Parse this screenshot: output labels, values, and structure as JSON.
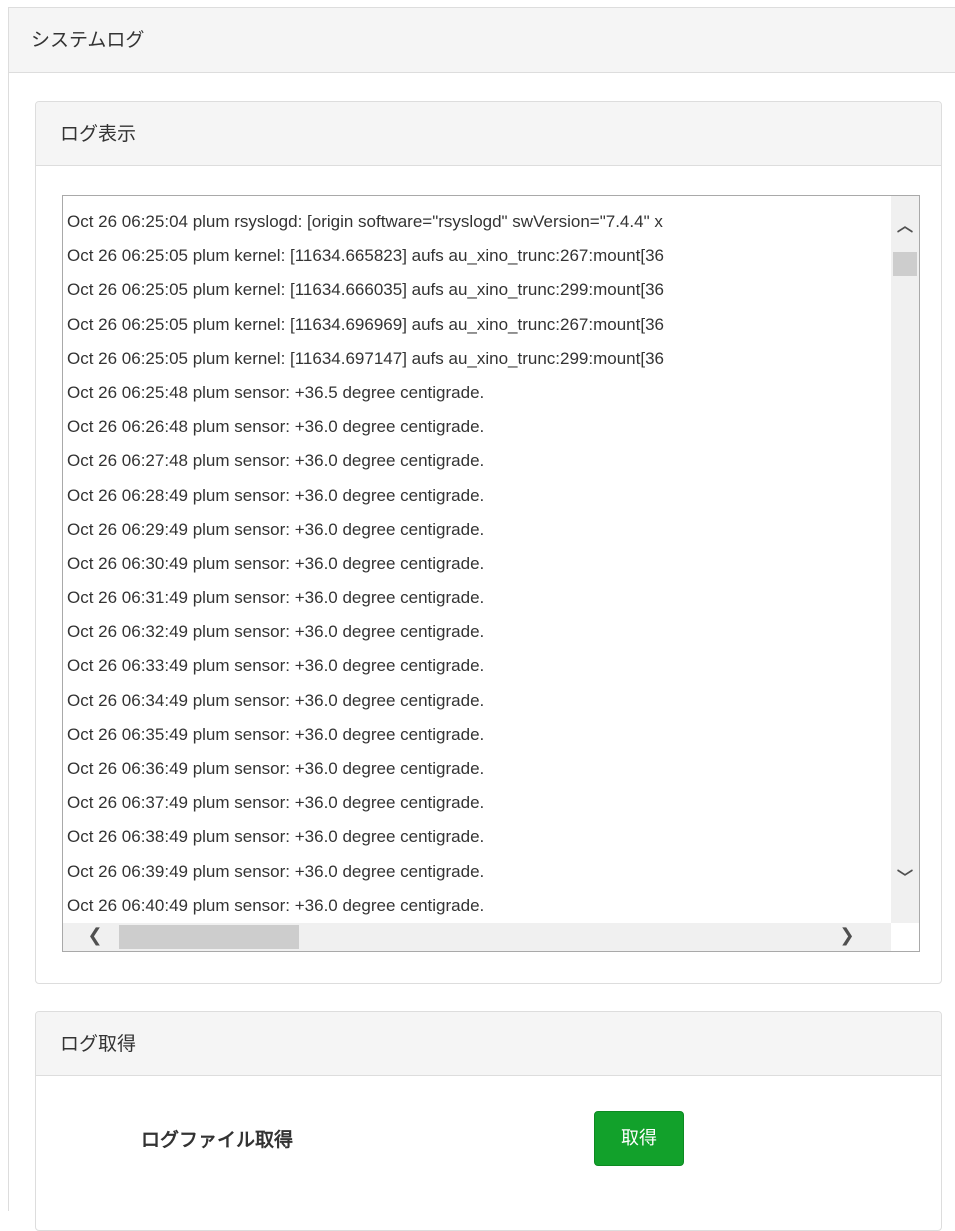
{
  "page": {
    "title": "システムログ"
  },
  "log_view": {
    "heading": "ログ表示",
    "lines": [
      "Oct 26 06:25:04 plum rsyslogd: [origin software=\"rsyslogd\" swVersion=\"7.4.4\" x",
      "Oct 26 06:25:05 plum kernel: [11634.665823] aufs au_xino_trunc:267:mount[36",
      "Oct 26 06:25:05 plum kernel: [11634.666035] aufs au_xino_trunc:299:mount[36",
      "Oct 26 06:25:05 plum kernel: [11634.696969] aufs au_xino_trunc:267:mount[36",
      "Oct 26 06:25:05 plum kernel: [11634.697147] aufs au_xino_trunc:299:mount[36",
      "Oct 26 06:25:48 plum sensor: +36.5 degree centigrade.",
      "Oct 26 06:26:48 plum sensor: +36.0 degree centigrade.",
      "Oct 26 06:27:48 plum sensor: +36.0 degree centigrade.",
      "Oct 26 06:28:49 plum sensor: +36.0 degree centigrade.",
      "Oct 26 06:29:49 plum sensor: +36.0 degree centigrade.",
      "Oct 26 06:30:49 plum sensor: +36.0 degree centigrade.",
      "Oct 26 06:31:49 plum sensor: +36.0 degree centigrade.",
      "Oct 26 06:32:49 plum sensor: +36.0 degree centigrade.",
      "Oct 26 06:33:49 plum sensor: +36.0 degree centigrade.",
      "Oct 26 06:34:49 plum sensor: +36.0 degree centigrade.",
      "Oct 26 06:35:49 plum sensor: +36.0 degree centigrade.",
      "Oct 26 06:36:49 plum sensor: +36.0 degree centigrade.",
      "Oct 26 06:37:49 plum sensor: +36.0 degree centigrade.",
      "Oct 26 06:38:49 plum sensor: +36.0 degree centigrade.",
      "Oct 26 06:39:49 plum sensor: +36.0 degree centigrade.",
      "Oct 26 06:40:49 plum sensor: +36.0 degree centigrade."
    ]
  },
  "log_get": {
    "heading": "ログ取得",
    "row_label": "ログファイル取得",
    "button_label": "取得",
    "button_color": "#12a12b"
  },
  "icons": {
    "scroll_up": "chevron-up-icon",
    "scroll_down": "chevron-down-icon",
    "scroll_left": "chevron-left-icon",
    "scroll_right": "chevron-right-icon"
  }
}
